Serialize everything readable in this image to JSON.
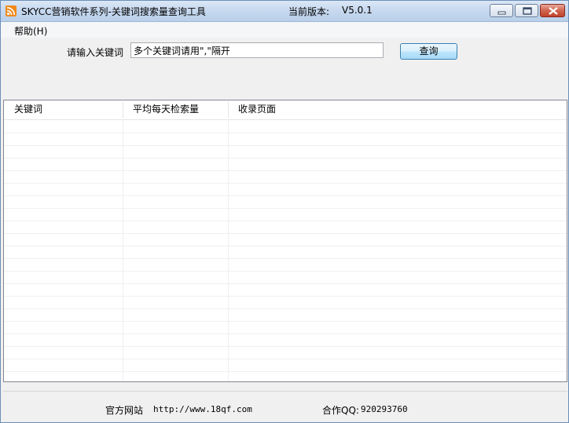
{
  "window": {
    "title": "SKYCC营销软件系列-关键词搜索量查询工具",
    "version_label": "当前版本:",
    "version_value": "V5.0.1",
    "icon": "rss-app-icon",
    "controls": [
      "minimize-icon",
      "maximize-icon",
      "close-icon"
    ]
  },
  "menu": {
    "help": "帮助(H)"
  },
  "search": {
    "label": "请输入关键词",
    "value": "多个关键词请用\",\"隔开",
    "button": "查询"
  },
  "table": {
    "columns": [
      "关键词",
      "平均每天检索量",
      "收录页面"
    ],
    "rows": []
  },
  "footer": {
    "site_label": "官方网站",
    "site_url": "http://www.18qf.com",
    "qq_label": "合作QQ:",
    "qq_value": "920293760"
  },
  "colors": {
    "titlebar": "#c6d8ef",
    "close_button": "#c0432a",
    "query_button": "#bee6fd"
  }
}
